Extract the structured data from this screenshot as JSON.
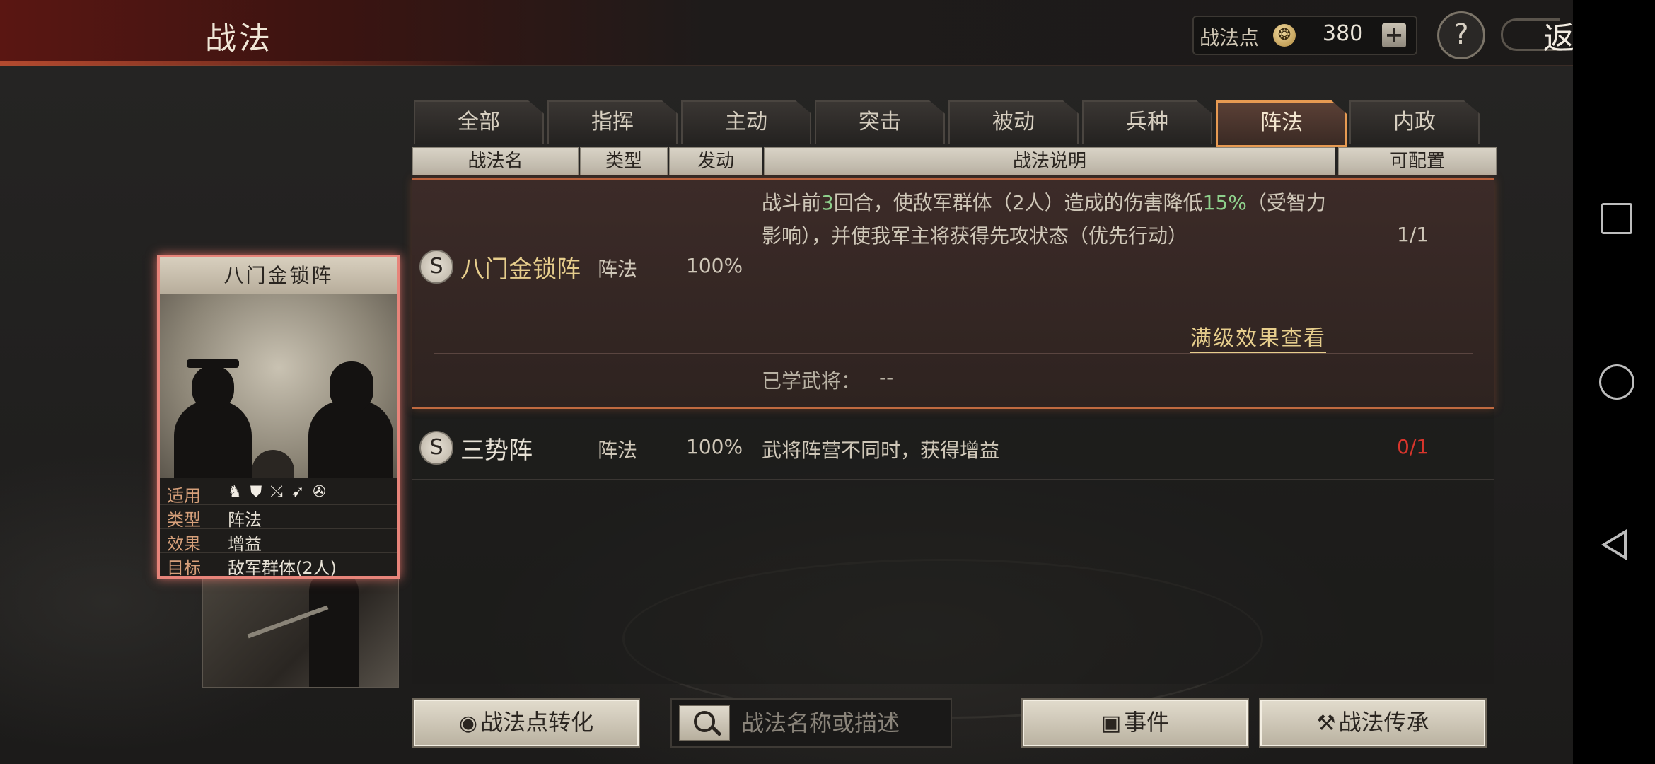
{
  "header": {
    "title": "战法",
    "points_label": "战法点",
    "points_value": "380",
    "plus_label": "+",
    "help_label": "?",
    "back_label": "返回"
  },
  "tabs": [
    {
      "label": "全部",
      "active": false
    },
    {
      "label": "指挥",
      "active": false
    },
    {
      "label": "主动",
      "active": false
    },
    {
      "label": "突击",
      "active": false
    },
    {
      "label": "被动",
      "active": false
    },
    {
      "label": "兵种",
      "active": false
    },
    {
      "label": "阵法",
      "active": true
    },
    {
      "label": "内政",
      "active": false
    }
  ],
  "columns": {
    "name": "战法名",
    "type": "类型",
    "trigger": "发动",
    "desc": "战法说明",
    "config": "可配置"
  },
  "tactics": [
    {
      "grade": "S",
      "name": "八门金锁阵",
      "type": "阵法",
      "rate": "100%",
      "desc_parts": [
        "战斗前",
        "3",
        "回合，使敌军群体（2人）造成的伤害降低",
        "15%",
        "（受智力影响），并使我军主将获得先攻状态（优先行动）"
      ],
      "config": "1/1",
      "full_effect_link": "满级效果查看",
      "learned_label": "已学武将：",
      "learned_value": "--"
    },
    {
      "grade": "S",
      "name": "三势阵",
      "type": "阵法",
      "rate": "100%",
      "desc": "武将阵营不同时，获得增益",
      "config": "0/1"
    }
  ],
  "card": {
    "title": "八门金锁阵",
    "rows": [
      {
        "key": "适用",
        "icons": [
          "cavalry-icon",
          "shield-icon",
          "bow-icon",
          "spear-icon",
          "chariot-icon"
        ]
      },
      {
        "key": "类型",
        "value": "阵法"
      },
      {
        "key": "效果",
        "value": "增益"
      },
      {
        "key": "目标",
        "value": "敌军群体(2人)"
      }
    ]
  },
  "bottom": {
    "convert_label": "战法点转化",
    "search_placeholder": "战法名称或描述",
    "event_label": "事件",
    "inherit_label": "战法传承"
  },
  "colors": {
    "accent_gold": "#e6cd8c",
    "accent_green": "#8ed08c",
    "accent_red": "#d8352c",
    "active_tab_border": "#e79a52",
    "card_border": "#e7847a"
  }
}
